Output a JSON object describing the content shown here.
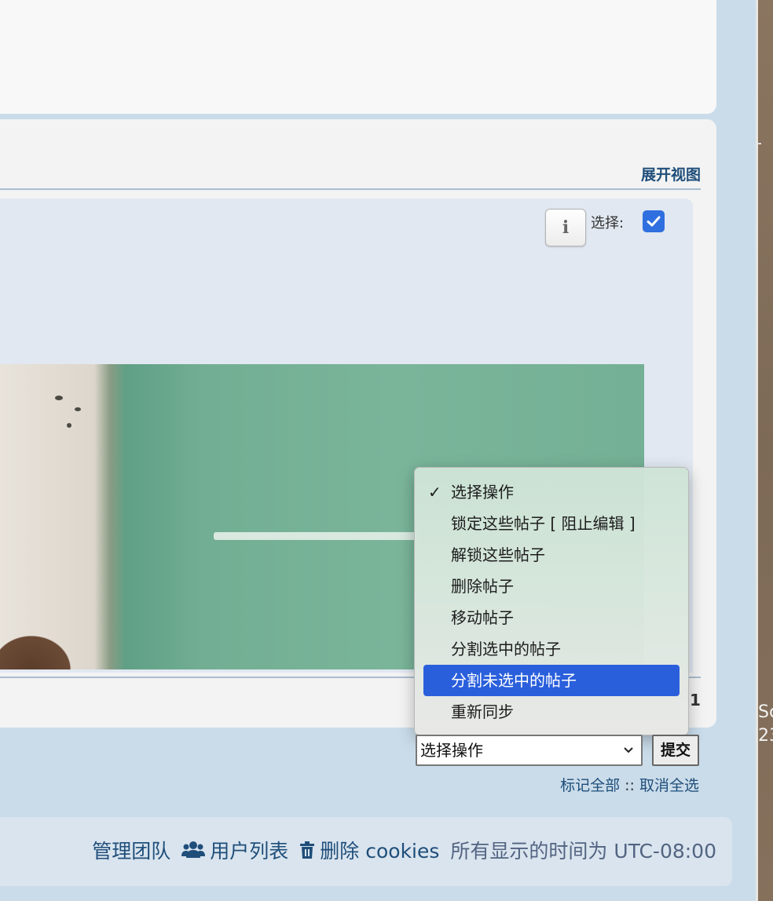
{
  "header": {
    "expand_view": "展开视图"
  },
  "post": {
    "select_label": "选择:"
  },
  "pagination": {
    "page": "1"
  },
  "dropdown": {
    "options": [
      "选择操作",
      "锁定这些帖子 [ 阻止编辑 ]",
      "解锁这些帖子",
      "删除帖子",
      "移动帖子",
      "分割选中的帖子",
      "分割未选中的帖子",
      "重新同步"
    ],
    "checked_index": 0,
    "highlighted_index": 6,
    "check_mark": "✓"
  },
  "actions": {
    "select_value": "选择操作",
    "submit_label": "提交",
    "mark_all": "标记全部",
    "separator": "::",
    "unmark_all": "取消全选"
  },
  "footer": {
    "team": "管理团队",
    "members": "用户列表",
    "delete_cookies": "删除 cookies",
    "timezone": "所有显示的时间为 UTC-08:00"
  },
  "side_strip": {
    "text": "Sc\n23"
  },
  "colors": {
    "link": "#1f4e7a",
    "highlight": "#2a5fdc",
    "checkbox": "#2f6fe0",
    "page_bg": "#cadcea"
  },
  "icons": {
    "info": "info-icon",
    "checkbox": "checkmark-icon",
    "members": "users-icon",
    "delete": "trash-icon",
    "select": "chevron-down-icon"
  }
}
